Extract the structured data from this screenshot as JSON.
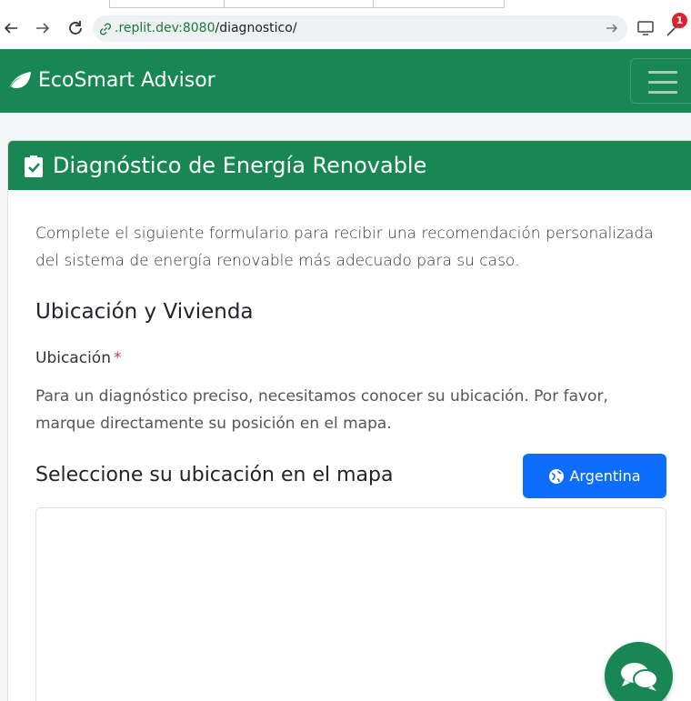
{
  "browser": {
    "url_host": ".replit.dev:8080",
    "url_path": "/diagnostico/",
    "extension_badge": "1"
  },
  "navbar": {
    "brand": "EcoSmart Advisor"
  },
  "card": {
    "title": "Diagnóstico de Energía Renovable",
    "intro": "Complete el siguiente formulario para recibir una recomendación personalizada del sistema de energía renovable más adecuado para su caso.",
    "section_title": "Ubicación y Vivienda",
    "location_label": "Ubicación",
    "required_mark": "*",
    "location_help": "Para un diagnóstico preciso, necesitamos conocer su ubicación. Por favor, marque directamente su posición en el mapa.",
    "map_title": "Seleccione su ubicación en el mapa",
    "country_button": "Argentina"
  },
  "colors": {
    "primary_green": "#198754",
    "button_blue": "#0d6efd",
    "required_red": "#dc3545"
  },
  "icons": {
    "back": "arrow-left-icon",
    "forward": "arrow-right-icon",
    "reload": "reload-icon",
    "brand": "leaf-icon",
    "menu": "hamburger-icon",
    "header": "clipboard-check-icon",
    "country": "globe-icon",
    "chat": "comments-icon"
  }
}
